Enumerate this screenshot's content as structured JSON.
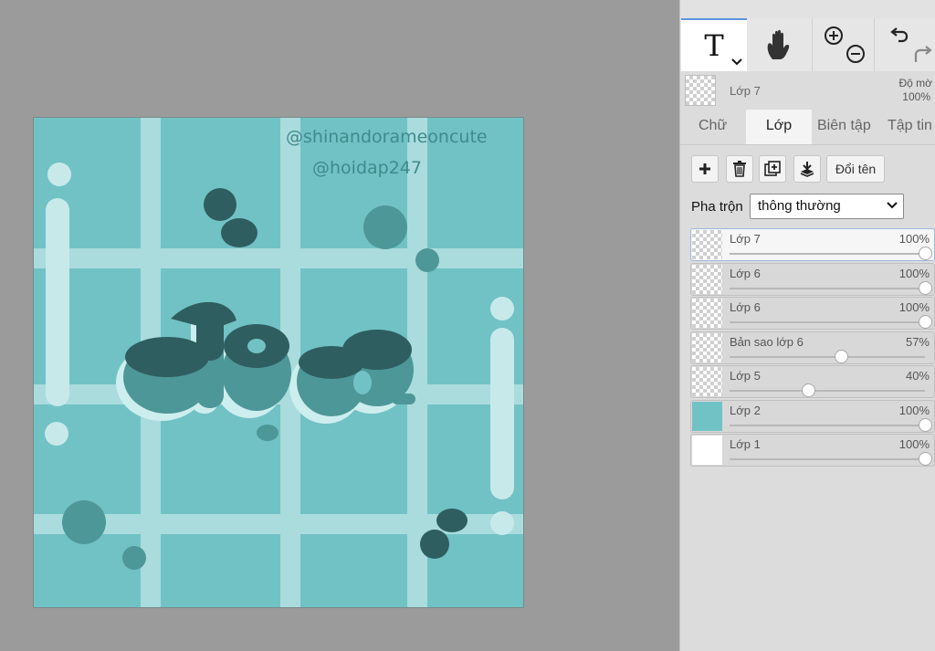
{
  "canvas": {
    "watermark_1": "@shinandorameoncute",
    "watermark_2": "@hoidap247",
    "artwork_word": "đẹp"
  },
  "toolbar": {
    "text_tool_glyph": "T",
    "text_tool_icon": "text-tool-icon",
    "hand_tool_icon": "hand-icon",
    "zoom_icons": [
      "zoom-in-icon",
      "zoom-out-icon"
    ],
    "history_icons": [
      "undo-icon",
      "redo-icon"
    ]
  },
  "current_layer": {
    "name": "Lớp 7",
    "opacity_label": "Độ mờ",
    "opacity_value": "100%"
  },
  "tabs": [
    {
      "label": "Chữ",
      "active": false
    },
    {
      "label": "Lớp",
      "active": true
    },
    {
      "label": "Biên tập",
      "active": false
    },
    {
      "label": "Tập tin",
      "active": false
    }
  ],
  "actions": {
    "add_icon": "plus-icon",
    "delete_icon": "trash-icon",
    "duplicate_icon": "duplicate-icon",
    "merge_icon": "merge-down-icon",
    "rename_label": "Đổi tên"
  },
  "blend": {
    "label": "Pha trộn",
    "value": "thông thường"
  },
  "layers": [
    {
      "name": "Lớp 7",
      "opacity": "100%",
      "level": 1.0,
      "active": true,
      "thumb": "transparent"
    },
    {
      "name": "Lớp 6",
      "opacity": "100%",
      "level": 1.0,
      "active": false,
      "thumb": "transparent"
    },
    {
      "name": "Lớp 6",
      "opacity": "100%",
      "level": 1.0,
      "active": false,
      "thumb": "transparent"
    },
    {
      "name": "Bản sao lớp 6",
      "opacity": "57%",
      "level": 0.57,
      "active": false,
      "thumb": "transparent"
    },
    {
      "name": "Lớp 5",
      "opacity": "40%",
      "level": 0.4,
      "active": false,
      "thumb": "transparent"
    },
    {
      "name": "Lớp 2",
      "opacity": "100%",
      "level": 1.0,
      "active": false,
      "thumb": "#71c2c5"
    },
    {
      "name": "Lớp 1",
      "opacity": "100%",
      "level": 1.0,
      "active": false,
      "thumb": "#ffffff"
    }
  ],
  "colors": {
    "canvas_bg": "#71c2c5",
    "grid_lines": "#aadcdd",
    "dark_teal": "#2f5e60",
    "mid_teal": "#4e9798",
    "accent_blue": "#5d93e0"
  }
}
